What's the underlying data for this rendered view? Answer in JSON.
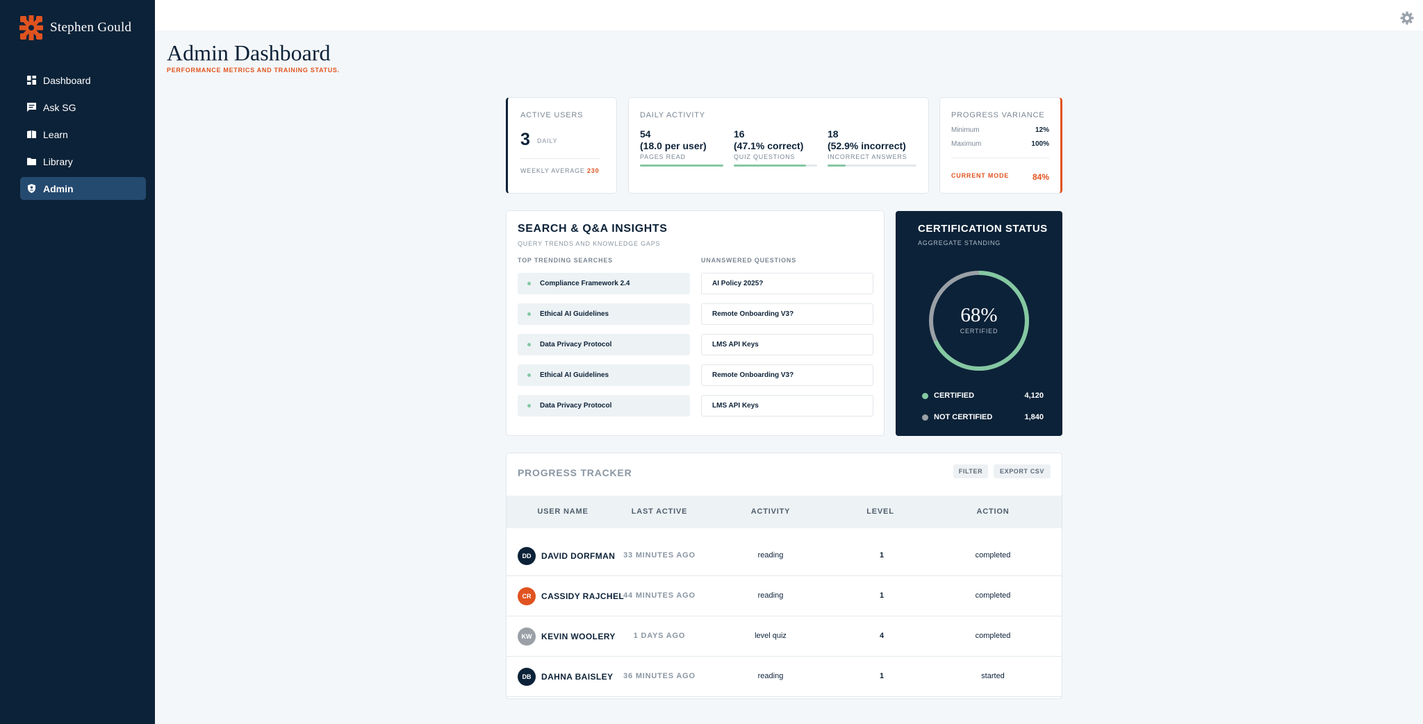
{
  "brand": {
    "name": "Stephen Gould",
    "accent": "#e0531f",
    "logo_icon": "gear-cross-logo"
  },
  "sidebar": {
    "items": [
      {
        "label": "Dashboard",
        "icon": "dashboard-icon",
        "active": false
      },
      {
        "label": "Ask SG",
        "icon": "chat-icon",
        "active": false
      },
      {
        "label": "Learn",
        "icon": "book-icon",
        "active": false
      },
      {
        "label": "Library",
        "icon": "folder-icon",
        "active": false
      },
      {
        "label": "Admin",
        "icon": "shield-icon",
        "active": true
      }
    ]
  },
  "header": {
    "title": "Admin Dashboard",
    "subtitle": "PERFORMANCE METRICS AND TRAINING STATUS.",
    "settings_icon": "gear-icon"
  },
  "active_users": {
    "label": "ACTIVE USERS",
    "value": "3",
    "unit": "DAILY",
    "weekly_label": "WEEKLY AVERAGE",
    "weekly_value": "230"
  },
  "daily_activity": {
    "label": "DAILY ACTIVITY",
    "stats": [
      {
        "value": "54",
        "detail": "(18.0 per user)",
        "caption": "PAGES READ",
        "progress": 1.0
      },
      {
        "value": "16",
        "detail": "(47.1% correct)",
        "caption": "QUIZ QUESTIONS",
        "progress": 0.87
      },
      {
        "value": "18",
        "detail": "(52.9% incorrect)",
        "caption": "INCORRECT ANSWERS",
        "progress": 0.2
      }
    ]
  },
  "progress_variance": {
    "label": "PROGRESS VARIANCE",
    "min_label": "Minimum",
    "min_value": "12%",
    "max_label": "Maximum",
    "max_value": "100%",
    "mode_label": "CURRENT MODE",
    "mode_value": "84%"
  },
  "search_insights": {
    "title": "SEARCH & Q&A INSIGHTS",
    "subtitle": "QUERY TRENDS AND KNOWLEDGE GAPS",
    "trending_label": "TOP TRENDING SEARCHES",
    "unanswered_label": "UNANSWERED QUESTIONS",
    "trending": [
      "Compliance Framework 2.4",
      "Ethical AI Guidelines",
      "Data Privacy Protocol",
      "Ethical AI Guidelines",
      "Data Privacy Protocol"
    ],
    "unanswered": [
      "AI Policy 2025?",
      "Remote Onboarding V3?",
      "LMS API Keys",
      "Remote Onboarding V3?",
      "LMS API Keys"
    ]
  },
  "certification": {
    "title": "CERTIFICATION STATUS",
    "subtitle": "AGGREGATE STANDING",
    "percent_label": "68%",
    "percent": 0.68,
    "caption": "CERTIFIED",
    "certified_label": "CERTIFIED",
    "certified_value": "4,120",
    "certified_color": "#84c8a2",
    "not_certified_label": "NOT CERTIFIED",
    "not_certified_value": "1,840",
    "not_certified_color": "#9aa0a6"
  },
  "tracker": {
    "title": "PROGRESS TRACKER",
    "filter_label": "FILTER",
    "export_label": "EXPORT CSV",
    "columns": [
      "USER NAME",
      "LAST ACTIVE",
      "ACTIVITY",
      "LEVEL",
      "ACTION"
    ],
    "rows": [
      {
        "initials": "DD",
        "avatar_color": "#0c2238",
        "name": "DAVID DORFMAN",
        "last_active": "33 MINUTES AGO",
        "activity": "reading",
        "level": "1",
        "action": "completed"
      },
      {
        "initials": "CR",
        "avatar_color": "#e0531f",
        "name": "CASSIDY RAJCHEL",
        "last_active": "44 MINUTES AGO",
        "activity": "reading",
        "level": "1",
        "action": "completed"
      },
      {
        "initials": "KW",
        "avatar_color": "#9aa0a6",
        "name": "KEVIN WOOLERY",
        "last_active": "1 DAYS AGO",
        "activity": "level quiz",
        "level": "4",
        "action": "completed"
      },
      {
        "initials": "DB",
        "avatar_color": "#0c2238",
        "name": "DAHNA BAISLEY",
        "last_active": "36 MINUTES AGO",
        "activity": "reading",
        "level": "1",
        "action": "started"
      }
    ]
  }
}
